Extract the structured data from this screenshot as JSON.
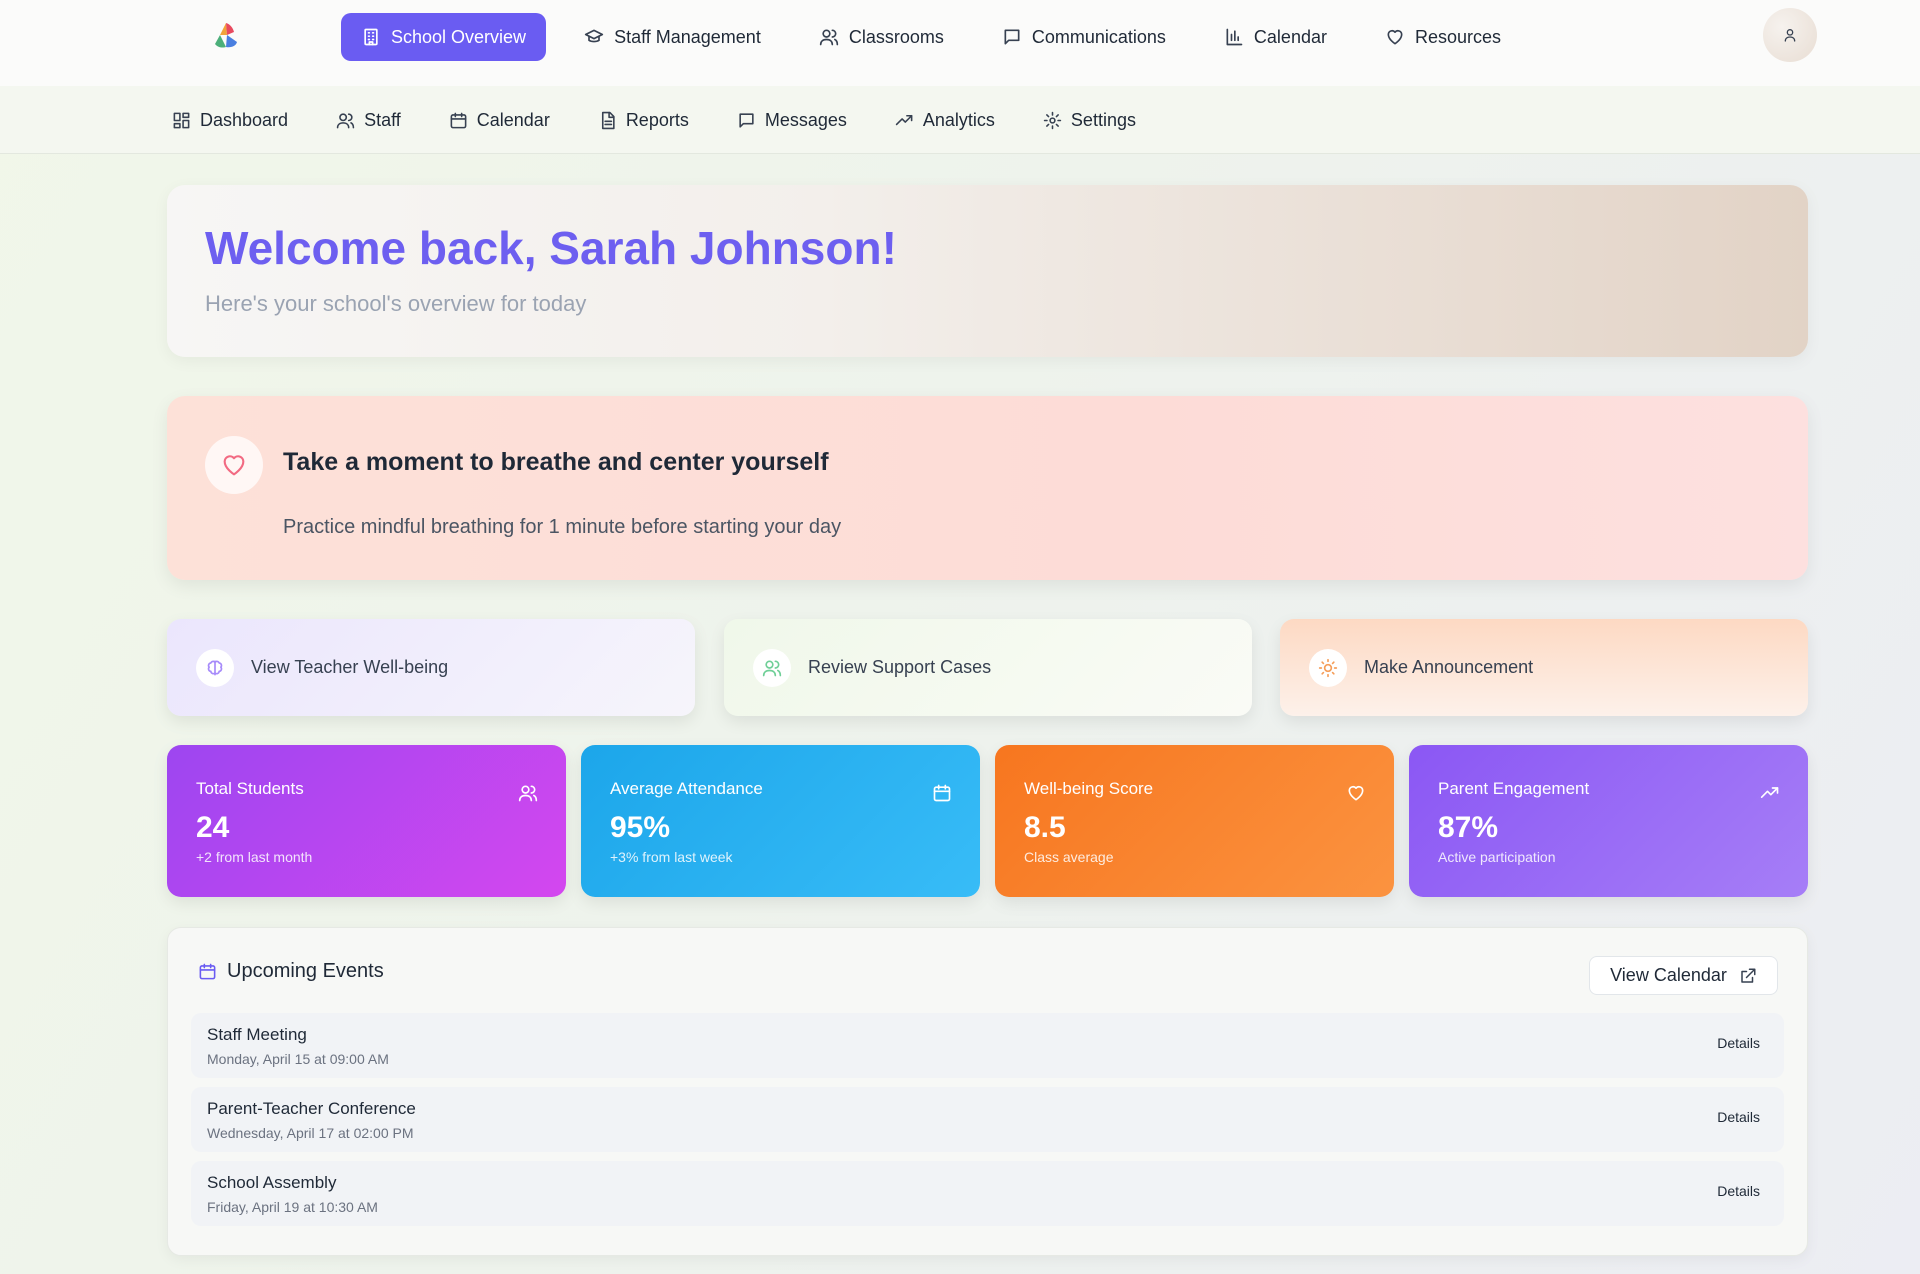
{
  "topnav": {
    "logo": "app-logo",
    "items": [
      {
        "label": "School Overview",
        "icon": "building-icon",
        "active": true
      },
      {
        "label": "Staff Management",
        "icon": "graduation-cap-icon"
      },
      {
        "label": "Classrooms",
        "icon": "users-icon"
      },
      {
        "label": "Communications",
        "icon": "message-square-icon"
      },
      {
        "label": "Calendar",
        "icon": "bar-chart-icon"
      },
      {
        "label": "Resources",
        "icon": "heart-icon"
      }
    ],
    "avatar_icon": "user-icon",
    "accent": "#6a5cf2"
  },
  "subnav": {
    "items": [
      {
        "label": "Dashboard",
        "icon": "grid-icon"
      },
      {
        "label": "Staff",
        "icon": "users-icon"
      },
      {
        "label": "Calendar",
        "icon": "calendar-icon"
      },
      {
        "label": "Reports",
        "icon": "file-text-icon"
      },
      {
        "label": "Messages",
        "icon": "message-square-icon"
      },
      {
        "label": "Analytics",
        "icon": "trending-up-icon"
      },
      {
        "label": "Settings",
        "icon": "gear-icon"
      }
    ]
  },
  "welcome": {
    "title": "Welcome back, Sarah Johnson!",
    "subtitle": "Here's your school's overview for today"
  },
  "mindful": {
    "icon": "heart-icon",
    "title": "Take a moment to breathe and center yourself",
    "text": "Practice mindful breathing for 1 minute before starting your day"
  },
  "actions": [
    {
      "label": "View Teacher Well-being",
      "icon": "brain-icon",
      "color": "#a78bfa"
    },
    {
      "label": "Review Support Cases",
      "icon": "users-icon",
      "color": "#6fcf97"
    },
    {
      "label": "Make Announcement",
      "icon": "sun-icon",
      "color": "#f59e5a"
    }
  ],
  "stats": [
    {
      "label": "Total Students",
      "value": "24",
      "note": "+2 from last month",
      "icon": "users-icon"
    },
    {
      "label": "Average Attendance",
      "value": "95%",
      "note": "+3% from last week",
      "icon": "calendar-icon"
    },
    {
      "label": "Well-being Score",
      "value": "8.5",
      "note": "Class average",
      "icon": "heart-icon"
    },
    {
      "label": "Parent Engagement",
      "value": "87%",
      "note": "Active participation",
      "icon": "trending-up-icon"
    }
  ],
  "events": {
    "title": "Upcoming Events",
    "view_calendar": "View Calendar",
    "items": [
      {
        "name": "Staff Meeting",
        "time": "Monday, April 15 at 09:00 AM",
        "action": "Details"
      },
      {
        "name": "Parent-Teacher Conference",
        "time": "Wednesday, April 17 at 02:00 PM",
        "action": "Details"
      },
      {
        "name": "School Assembly",
        "time": "Friday, April 19 at 10:30 AM",
        "action": "Details"
      }
    ]
  }
}
